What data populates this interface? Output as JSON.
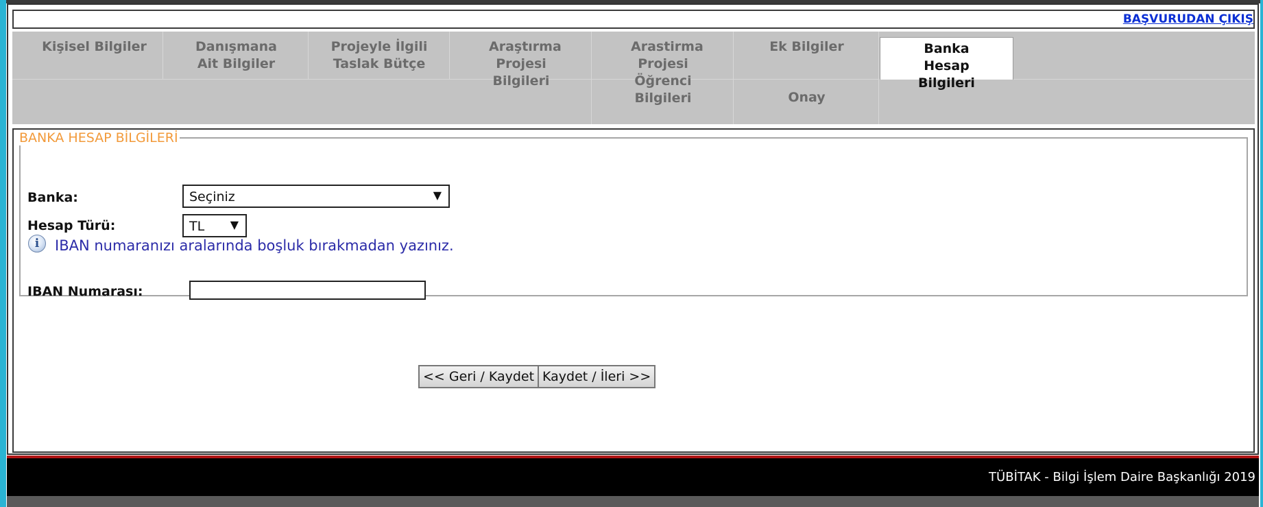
{
  "header": {
    "exit_link": "BAŞVURUDAN ÇIKIŞ"
  },
  "tabs": [
    {
      "label": "Kişisel Bilgiler"
    },
    {
      "label": "Danışmana Ait Bilgiler"
    },
    {
      "label": "Projeyle İlgili Taslak Bütçe"
    },
    {
      "label": "Araştırma Projesi Bilgileri"
    },
    {
      "label": "Arastirma Projesi Öğrenci Bilgileri"
    },
    {
      "label": "Ek Bilgiler"
    },
    {
      "label": "Banka Hesap Bilgileri",
      "active": true
    },
    {
      "label": "Onay"
    }
  ],
  "form": {
    "legend": "BANKA HESAP BİLGİLERİ",
    "bank_label": "Banka:",
    "bank_value": "Seçiniz",
    "account_type_label": "Hesap Türü:",
    "account_type_value": "TL",
    "iban_info": "IBAN numaranızı aralarında boşluk bırakmadan yazınız.",
    "iban_label": "IBAN Numarası:",
    "iban_value": ""
  },
  "buttons": {
    "back_save": "<< Geri / Kaydet",
    "save_next": "Kaydet / İleri >>"
  },
  "footer": {
    "text": "TÜBİTAK - Bilgi İşlem Daire Başkanlığı 2019"
  },
  "colors": {
    "accent_cyan": "#2ab4d4",
    "link_blue": "#0b2fd4",
    "legend_orange": "#f29a3a",
    "tab_bg": "#c3c3c3",
    "footer_red": "#b01414"
  },
  "icons": {
    "info": "info-icon",
    "dropdown": "chevron-down-icon"
  }
}
